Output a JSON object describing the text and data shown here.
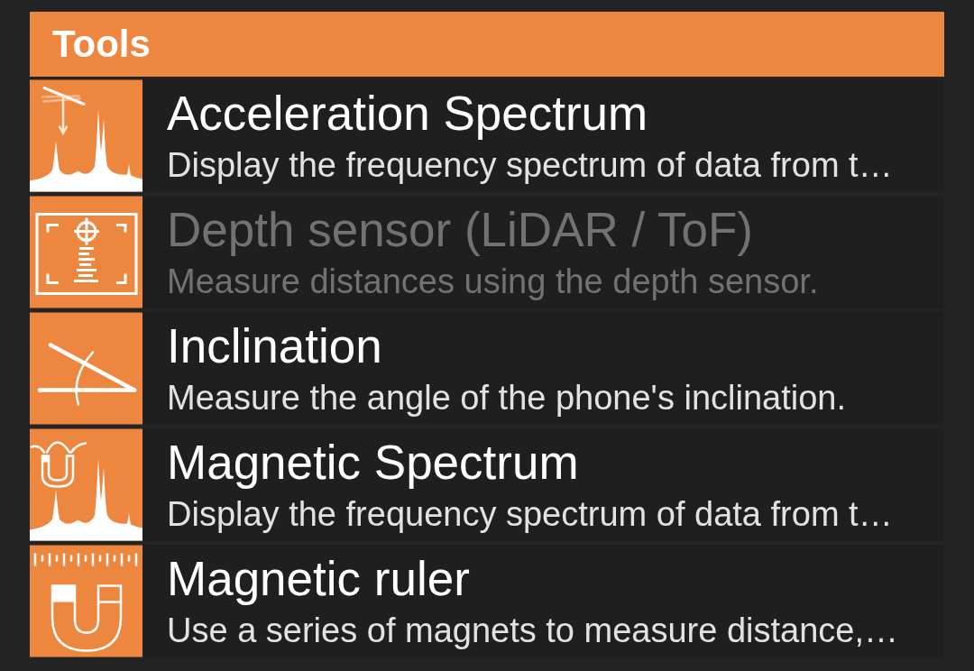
{
  "header": {
    "title": "Tools"
  },
  "tools": [
    {
      "title": "Acceleration Spectrum",
      "description": "Display the frequency spectrum of data from t…",
      "disabled": false
    },
    {
      "title": "Depth sensor (LiDAR / ToF)",
      "description": "Measure distances using the depth sensor.",
      "disabled": true
    },
    {
      "title": "Inclination",
      "description": "Measure the angle of the phone's inclination.",
      "disabled": false
    },
    {
      "title": "Magnetic Spectrum",
      "description": "Display the frequency spectrum of data from t…",
      "disabled": false
    },
    {
      "title": "Magnetic ruler",
      "description": "Use a series of magnets to measure distance,…",
      "disabled": false
    }
  ]
}
